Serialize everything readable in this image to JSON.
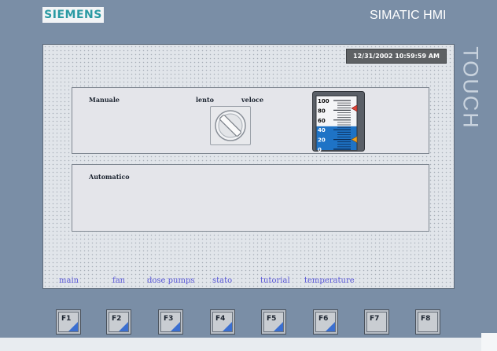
{
  "device": {
    "brand": "SIEMENS",
    "product": "SIMATIC HMI",
    "side_label": "TOUCH"
  },
  "screen": {
    "datetime": "12/31/2002 10:59:59 AM",
    "manual_panel": {
      "title": "Manuale",
      "slow_label": "lento",
      "fast_label": "veloce"
    },
    "auto_panel": {
      "title": "Automatico"
    },
    "gauge": {
      "scale_max": 100,
      "scale_min": 0,
      "tick_labels": [
        "100",
        "80",
        "60",
        "40",
        "20",
        "0"
      ],
      "fill_level_percent": 47,
      "upper_marker_percent": 84,
      "lower_marker_percent": 20,
      "fill_color": "#1e73c6",
      "upper_marker_color": "#e0453a",
      "lower_marker_color": "#f0a020"
    },
    "nav": [
      "main",
      "fan",
      "dose pumps",
      "stato",
      "tutorial",
      "temperature"
    ]
  },
  "function_keys": [
    "F1",
    "F2",
    "F3",
    "F4",
    "F5",
    "F6",
    "F7",
    "F8"
  ],
  "function_keys_with_corner": [
    true,
    true,
    true,
    true,
    true,
    true,
    false,
    false
  ],
  "colors": {
    "bezel": "#7a8ea6",
    "accent_blue": "#3b6fd0",
    "nav_link": "#5a58d8"
  }
}
